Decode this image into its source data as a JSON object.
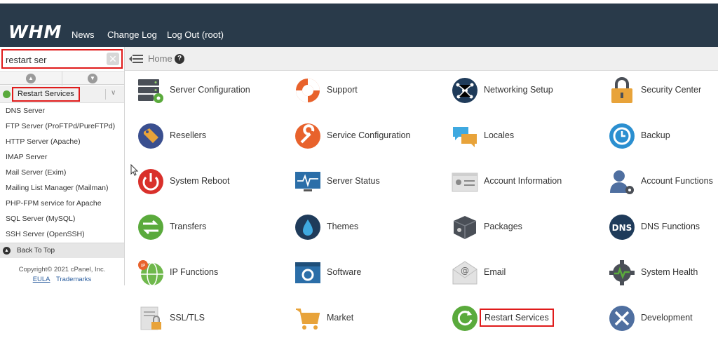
{
  "header": {
    "logo": "WHM",
    "nav": [
      "News",
      "Change Log",
      "Log Out (root)"
    ]
  },
  "sidebar": {
    "search_value": "restart ser",
    "category": "Restart Services",
    "items": [
      "DNS Server",
      "FTP Server (ProFTPd/PureFTPd)",
      "HTTP Server (Apache)",
      "IMAP Server",
      "Mail Server (Exim)",
      "Mailing List Manager (Mailman)",
      "PHP-FPM service for Apache",
      "SQL Server (MySQL)",
      "SSH Server (OpenSSH)"
    ],
    "back_to_top": "Back To Top",
    "copyright": "Copyright© 2021 cPanel, Inc.",
    "eula": "EULA",
    "trademarks": "Trademarks"
  },
  "breadcrumb": {
    "home": "Home"
  },
  "grid": {
    "columns": [
      [
        "Server Configuration",
        "Resellers",
        "System Reboot",
        "Transfers",
        "IP Functions",
        "SSL/TLS"
      ],
      [
        "Support",
        "Service Configuration",
        "Server Status",
        "Themes",
        "Software",
        "Market"
      ],
      [
        "Networking Setup",
        "Locales",
        "Account Information",
        "Packages",
        "Email",
        "Restart Services"
      ],
      [
        "Security Center",
        "Backup",
        "Account Functions",
        "DNS Functions",
        "System Health",
        "Development"
      ]
    ]
  },
  "colors": {
    "header_bg": "#293a4a",
    "highlight": "#e01b1b",
    "accent_orange": "#e8622c",
    "accent_blue": "#2b6ea8",
    "accent_green": "#5aaa3c"
  }
}
